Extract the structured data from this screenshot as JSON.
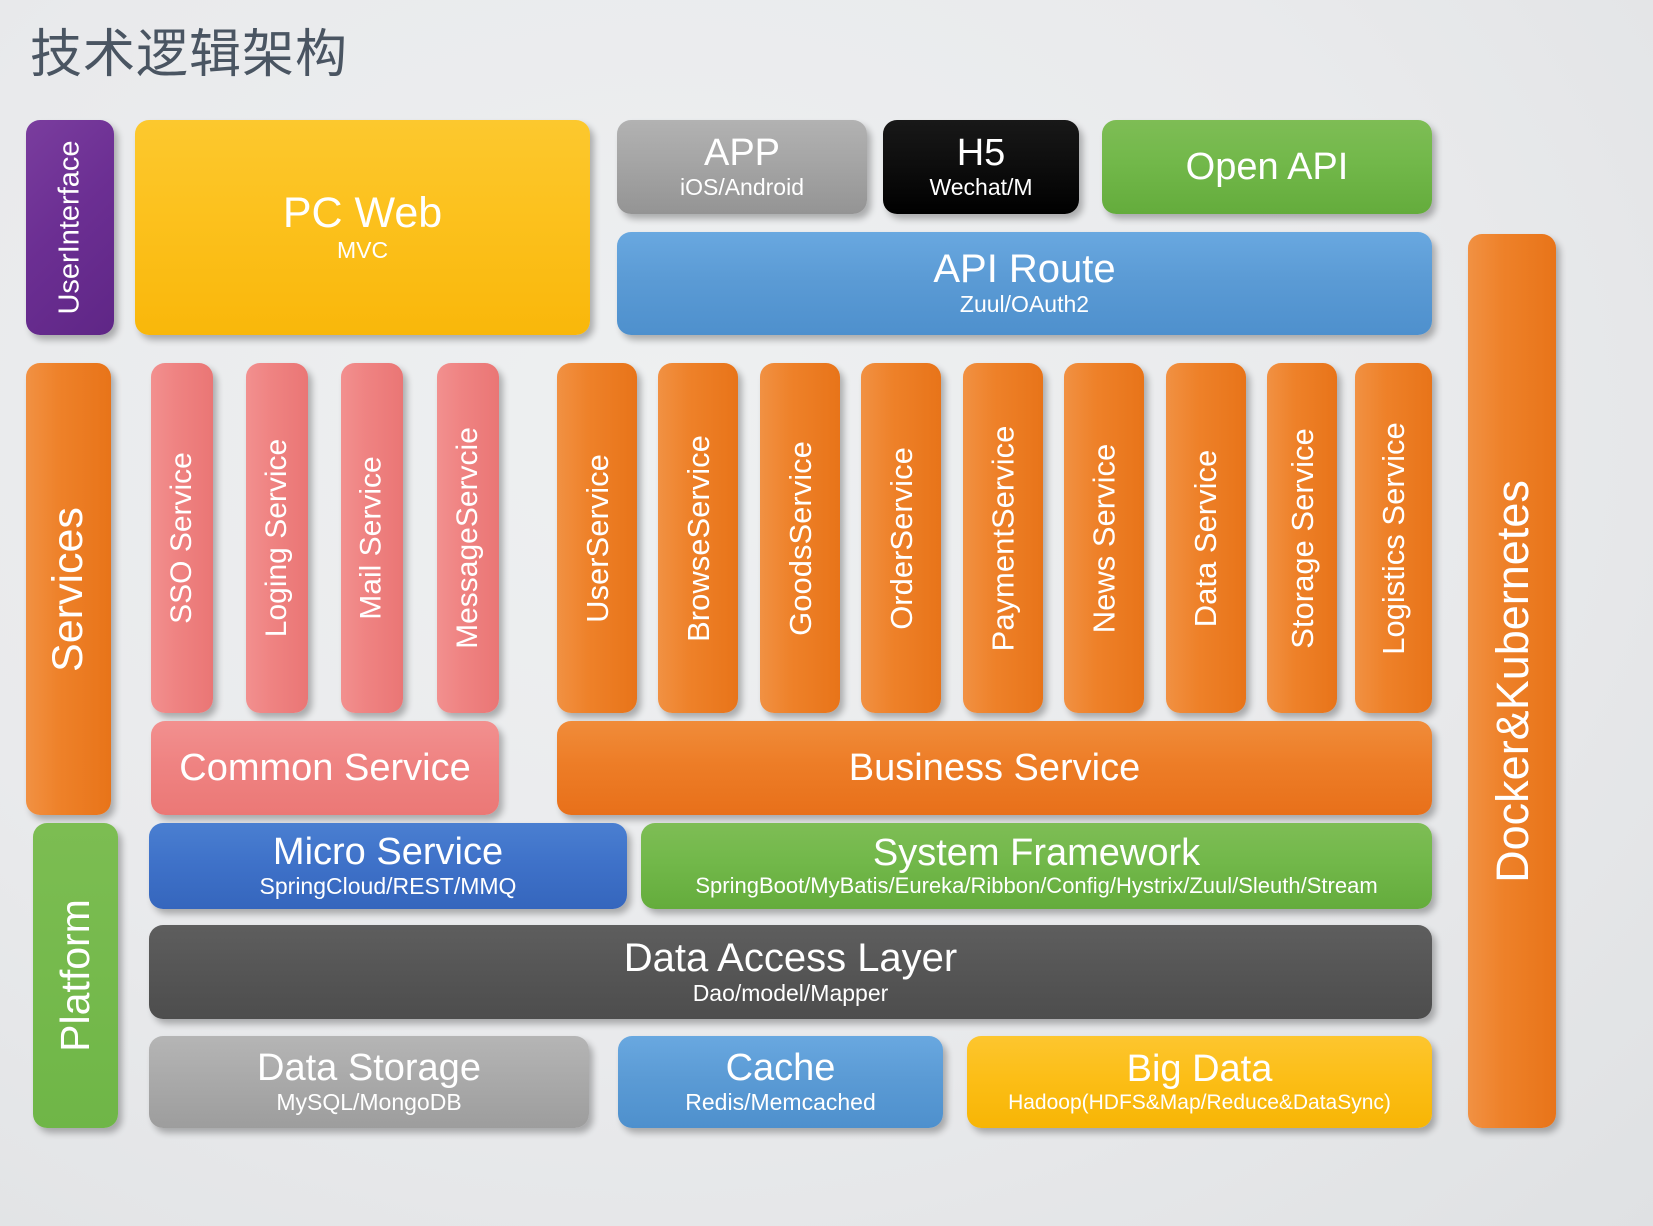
{
  "title": "技术逻辑架构",
  "colors": {
    "background": "#eaebec",
    "title_text": "#4a5562",
    "purple": "#6c2f93",
    "yellow": "#fcc21f",
    "gray": "#a5a5a5",
    "black": "#000000",
    "green": "#72b84a",
    "blue": "#5b9bd5",
    "orange": "#ed7d27",
    "pink": "#ef8382",
    "micro_blue": "#3f72c9",
    "dark_gray": "#565656",
    "gold": "#fcbe17"
  },
  "layers": {
    "user_interface": {
      "label": "UserInterface"
    },
    "services": {
      "label": "Services"
    },
    "platform": {
      "label": "Platform"
    },
    "infrastructure": {
      "label": "Docker&Kubernetes"
    }
  },
  "channels": [
    {
      "name": "PC Web",
      "sub": "MVC"
    },
    {
      "name": "APP",
      "sub": "iOS/Android"
    },
    {
      "name": "H5",
      "sub": "Wechat/M"
    },
    {
      "name": "Open API",
      "sub": ""
    }
  ],
  "gateway": {
    "name": "API Route",
    "sub": "Zuul/OAuth2"
  },
  "common_services": [
    {
      "name": "SSO Service"
    },
    {
      "name": "Loging Service"
    },
    {
      "name": "Mail Service"
    },
    {
      "name": "MessageServcie"
    }
  ],
  "common_service_group": {
    "label": "Common Service"
  },
  "business_services": [
    {
      "name": "UserService"
    },
    {
      "name": "BrowseService"
    },
    {
      "name": "GoodsService"
    },
    {
      "name": "OrderService"
    },
    {
      "name": "PaymentService"
    },
    {
      "name": "News Service"
    },
    {
      "name": "Data Service"
    },
    {
      "name": "Storage Service"
    },
    {
      "name": "Logistics Service"
    }
  ],
  "business_service_group": {
    "label": "Business Service"
  },
  "platform_rows": {
    "micro_service": {
      "name": "Micro Service",
      "sub": "SpringCloud/REST/MMQ"
    },
    "system_framework": {
      "name": "System Framework",
      "sub": "SpringBoot/MyBatis/Eureka/Ribbon/Config/Hystrix/Zuul/Sleuth/Stream"
    },
    "data_access_layer": {
      "name": "Data Access Layer",
      "sub": "Dao/model/Mapper"
    },
    "data_storage": {
      "name": "Data Storage",
      "sub": "MySQL/MongoDB"
    },
    "cache": {
      "name": "Cache",
      "sub": "Redis/Memcached"
    },
    "big_data": {
      "name": "Big Data",
      "sub": "Hadoop(HDFS&Map/Reduce&DataSync)"
    }
  }
}
